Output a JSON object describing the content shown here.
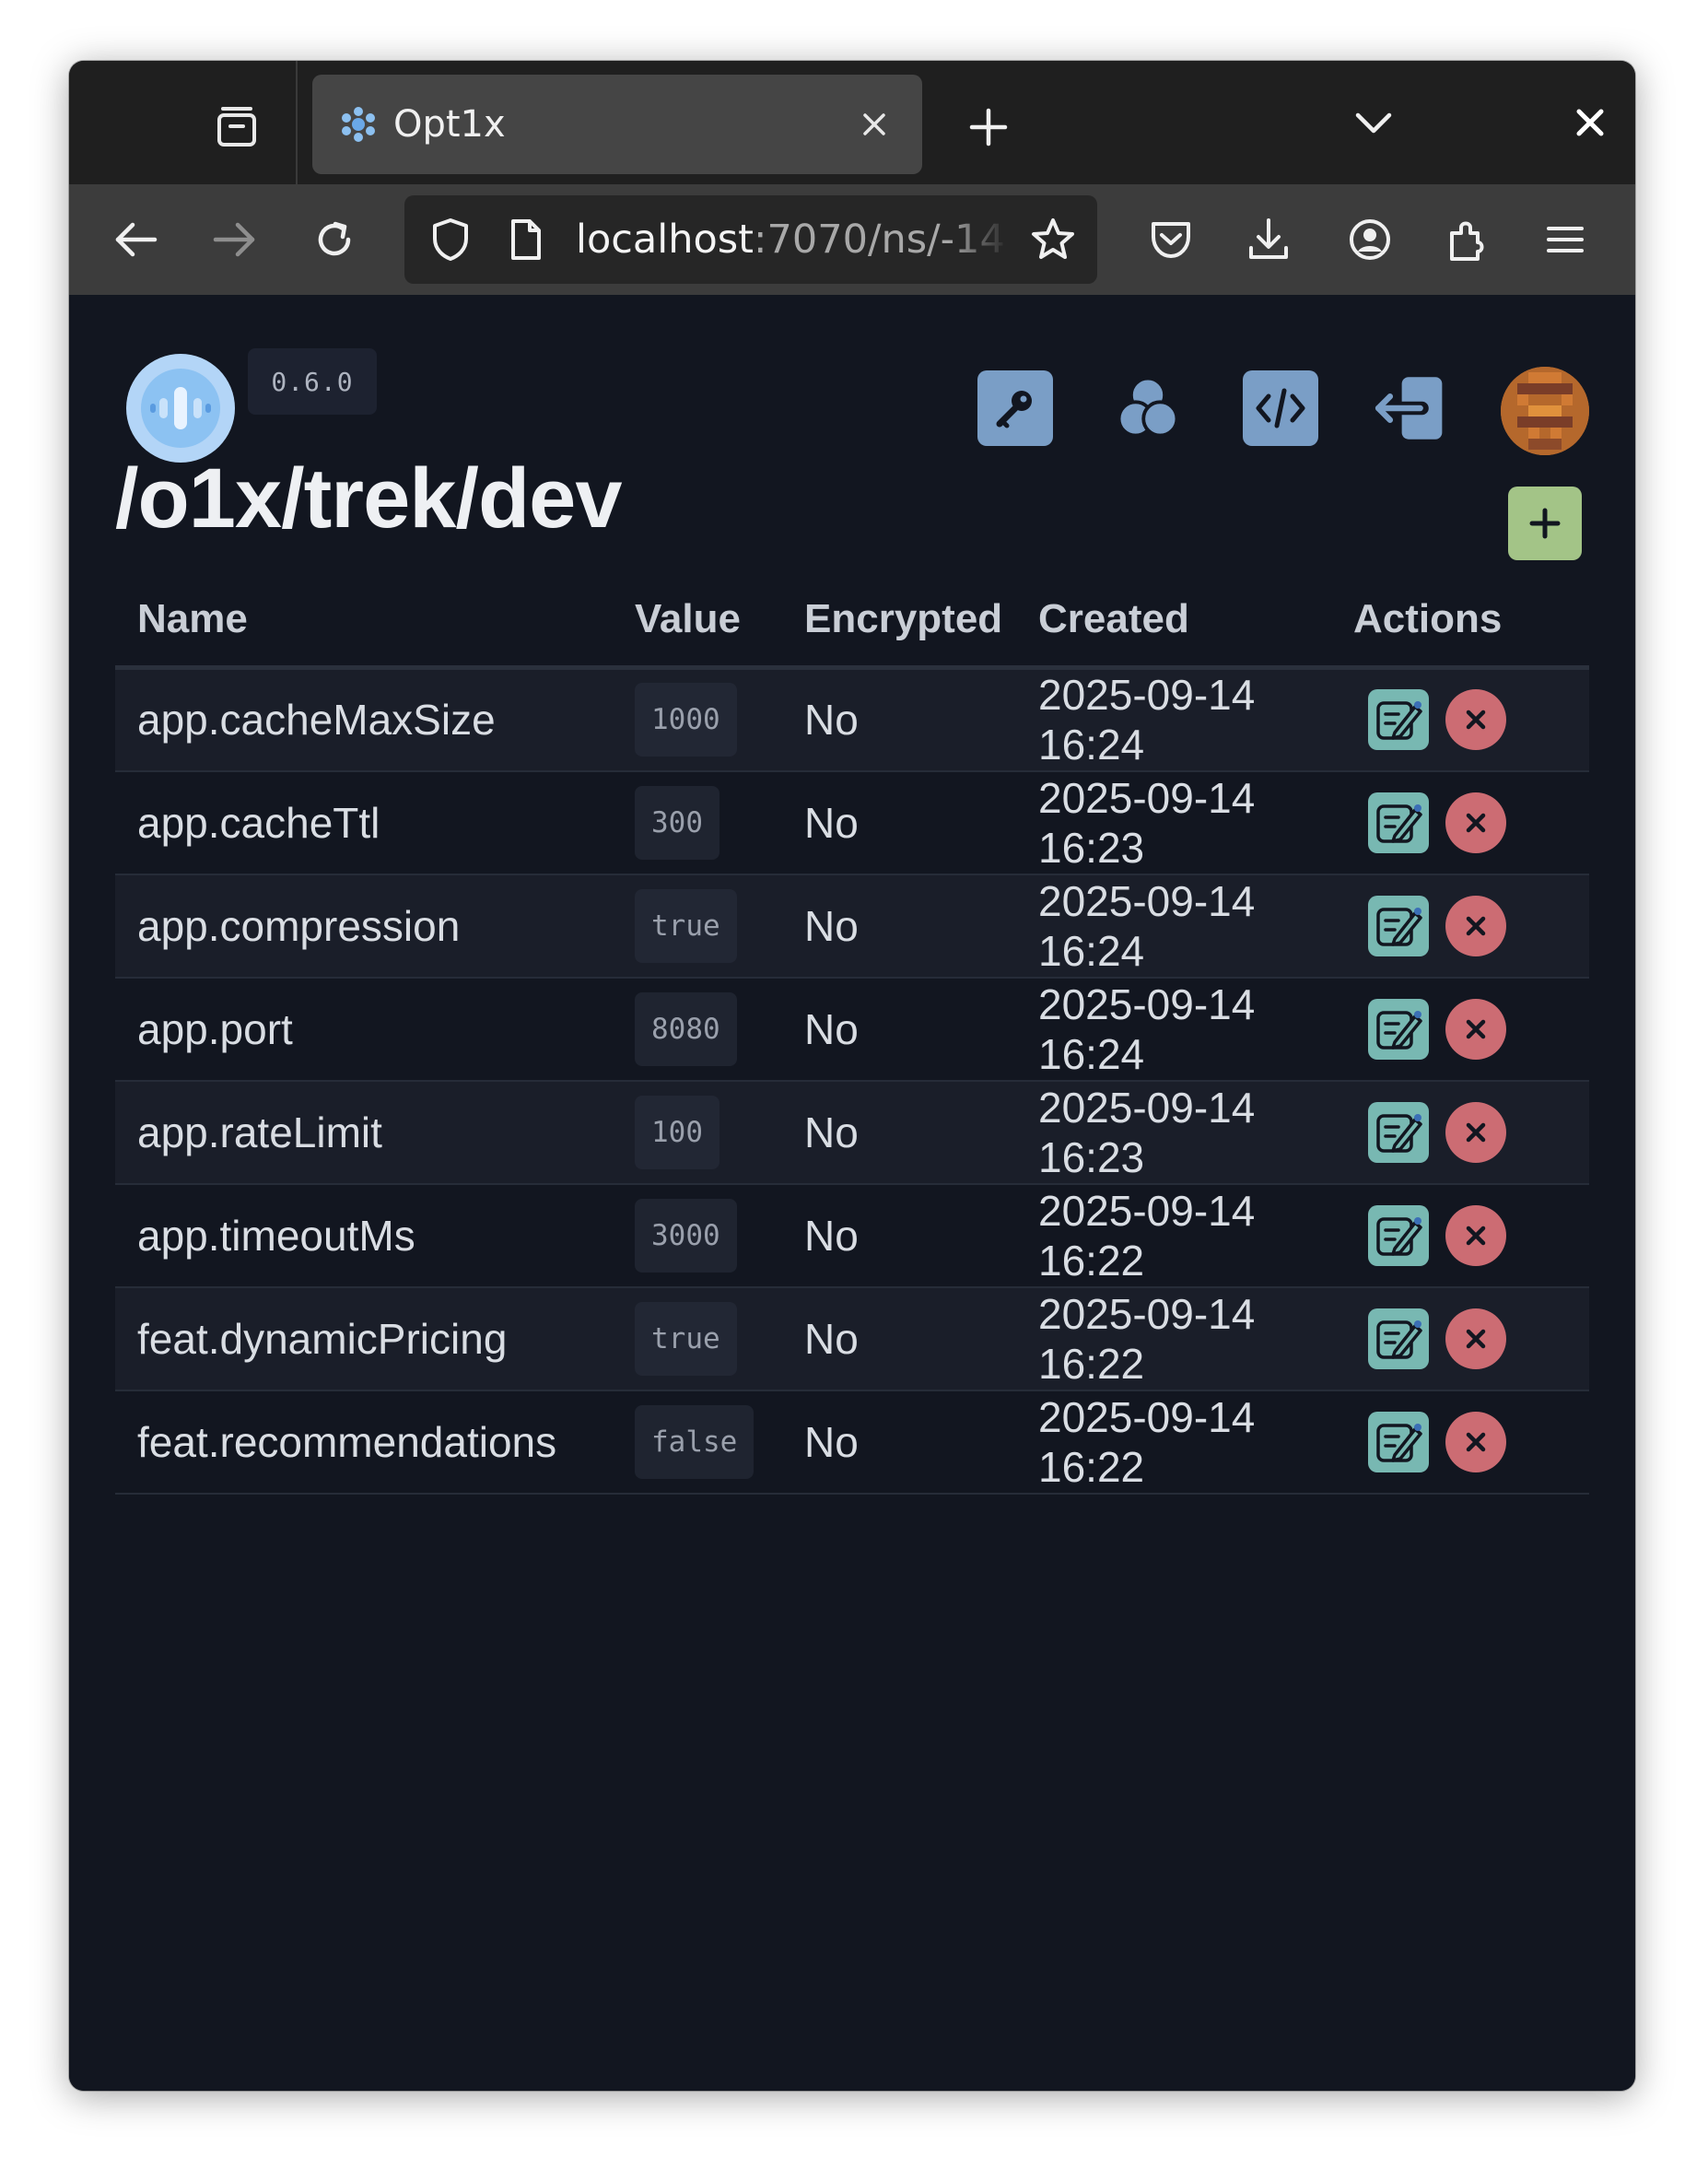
{
  "browser": {
    "tab_title": "Opt1x",
    "url_host": "localhost",
    "url_rest": ":7070/ns/-140",
    "icons": {
      "overview": "tab-overview-icon",
      "favicon": "opt1x-favicon",
      "tab_close": "close-icon",
      "new_tab": "plus-icon",
      "tab_list": "chevron-down-icon",
      "window_close": "close-icon",
      "back": "arrow-left-icon",
      "forward": "arrow-right-icon",
      "reload": "reload-icon",
      "shield": "shield-icon",
      "page": "page-icon",
      "bookmark": "star-icon",
      "pocket": "pocket-icon",
      "downloads": "download-icon",
      "account": "account-icon",
      "extensions": "extensions-icon",
      "menu": "hamburger-menu-icon"
    }
  },
  "app": {
    "version": "0.6.0",
    "header_icons": [
      "key-icon",
      "groups-icon",
      "code-icon",
      "logout-icon",
      "user-avatar"
    ],
    "page_title": "/o1x/trek/dev",
    "add_button_icon": "plus-icon",
    "colors": {
      "background": "#121620",
      "header_button": "#7a9ec6",
      "add_button": "#a3c487",
      "edit_button": "#78b8b2",
      "delete_button": "#cc6c73"
    },
    "table": {
      "columns": [
        "Name",
        "Value",
        "Encrypted",
        "Created",
        "Actions"
      ],
      "rows": [
        {
          "name": "app.cacheMaxSize",
          "value": "1000",
          "encrypted": "No",
          "created": "2025-09-14 16:24"
        },
        {
          "name": "app.cacheTtl",
          "value": "300",
          "encrypted": "No",
          "created": "2025-09-14 16:23"
        },
        {
          "name": "app.compression",
          "value": "true",
          "encrypted": "No",
          "created": "2025-09-14 16:24"
        },
        {
          "name": "app.port",
          "value": "8080",
          "encrypted": "No",
          "created": "2025-09-14 16:24"
        },
        {
          "name": "app.rateLimit",
          "value": "100",
          "encrypted": "No",
          "created": "2025-09-14 16:23"
        },
        {
          "name": "app.timeoutMs",
          "value": "3000",
          "encrypted": "No",
          "created": "2025-09-14 16:22"
        },
        {
          "name": "feat.dynamicPricing",
          "value": "true",
          "encrypted": "No",
          "created": "2025-09-14 16:22"
        },
        {
          "name": "feat.recommendations",
          "value": "false",
          "encrypted": "No",
          "created": "2025-09-14 16:22"
        }
      ]
    }
  }
}
